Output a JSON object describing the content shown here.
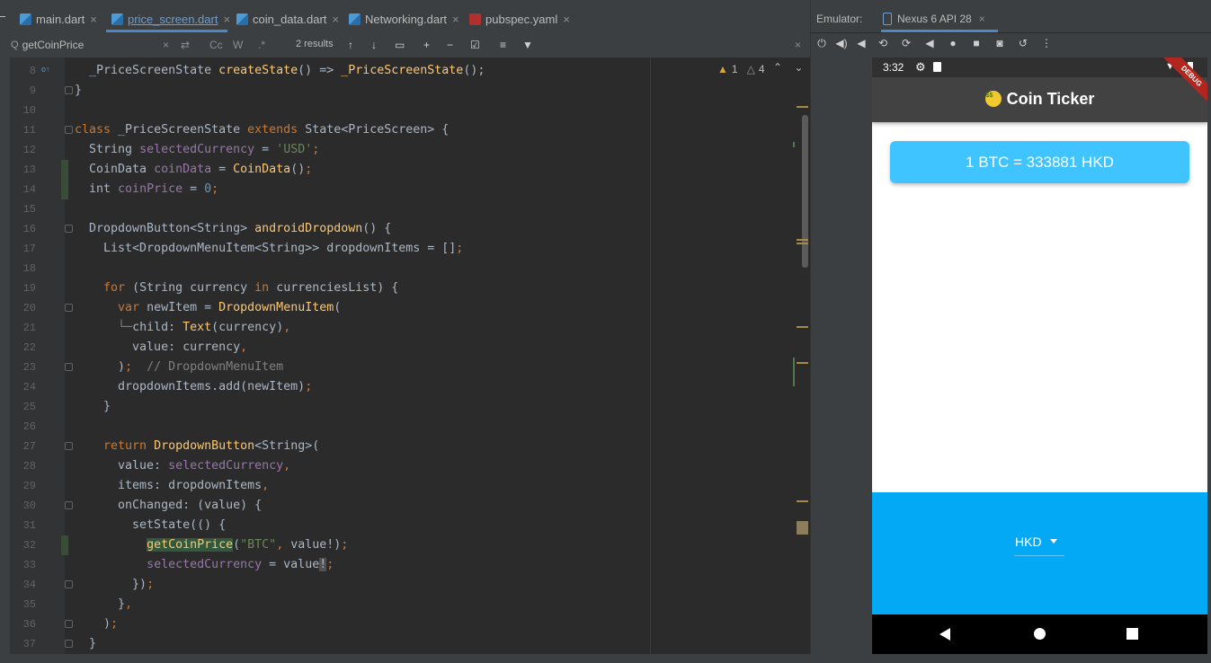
{
  "editor": {
    "tabs": [
      {
        "label": "main.dart",
        "icon": "dart-file-icon",
        "active": false
      },
      {
        "label": "price_screen.dart",
        "icon": "dart-file-icon",
        "active": true
      },
      {
        "label": "coin_data.dart",
        "icon": "dart-file-icon",
        "active": false
      },
      {
        "label": "Networking.dart",
        "icon": "dart-file-icon",
        "active": false
      },
      {
        "label": "pubspec.yaml",
        "icon": "yaml-file-icon",
        "active": false
      }
    ],
    "close_glyph": "×",
    "find": {
      "query": "getCoinPrice",
      "results": "2 results",
      "match_case": "Cc",
      "words": "W",
      "regex": ".*"
    },
    "inspections": {
      "warnings": "1",
      "weak_warnings": "4"
    },
    "line_numbers": [
      "8",
      "9",
      "10",
      "11",
      "12",
      "13",
      "14",
      "15",
      "16",
      "17",
      "18",
      "19",
      "20",
      "21",
      "22",
      "23",
      "24",
      "25",
      "26",
      "27",
      "28",
      "29",
      "30",
      "31",
      "32",
      "33",
      "34",
      "35",
      "36",
      "37"
    ],
    "colors": {
      "keyword": "#cc7832",
      "function": "#ffc66d",
      "string": "#6a8759",
      "number": "#6897bb",
      "field": "#9876aa",
      "comment": "#808080"
    }
  },
  "emulator": {
    "label": "Emulator:",
    "device_tab": "Nexus 6 API 28",
    "phone": {
      "status_time": "3:32",
      "app_title": "Coin Ticker",
      "debug_banner": "DEBUG",
      "price_text": "1 BTC = 333881 HKD",
      "selected_currency": "HKD",
      "colors": {
        "app_bar": "#424242",
        "card": "#40c4ff",
        "bottom_panel": "#03a9f4"
      }
    }
  }
}
